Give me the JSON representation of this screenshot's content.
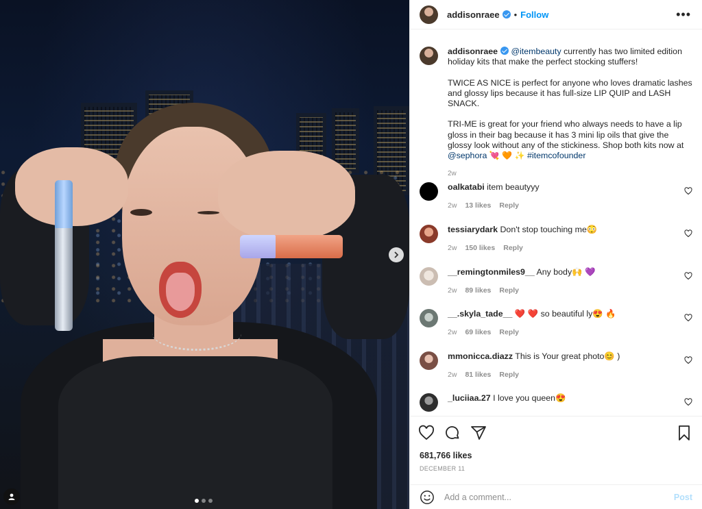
{
  "post": {
    "username": "addisonraee",
    "follow_label": "Follow",
    "separator": "•",
    "more_label": "•••",
    "caption": {
      "mention_start": "@itembeauty",
      "line1": " currently has two limited edition holiday kits that make the perfect stocking stuffers!",
      "para2": "TWICE AS NICE is perfect for anyone who loves dramatic lashes and glossy lips because it has full-size LIP QUIP and LASH SNACK.",
      "para3_text": "TRI-ME is great for your friend who always needs to have a lip gloss in their bag because it has 3 mini lip oils that give the glossy look without any of the stickiness. Shop both kits now at ",
      "para3_mention": "@sephora",
      "para3_emoji1": "💘",
      "para3_emoji2": "🧡",
      "para3_emoji3": "✨",
      "hashtag": "#itemcofounder",
      "time": "2w"
    },
    "likes": "681,766 likes",
    "date": "DECEMBER 11",
    "add_comment_placeholder": "Add a comment...",
    "post_label": "Post"
  },
  "comments": [
    {
      "username": "oalkatabi",
      "text": "item beautyyy",
      "time": "2w",
      "likes": "13 likes",
      "reply": "Reply",
      "avatar_color": "#000000"
    },
    {
      "username": "tessiarydark",
      "text": "Don't stop touching me😳",
      "time": "2w",
      "likes": "150 likes",
      "reply": "Reply",
      "avatar_color": "#c96a4f"
    },
    {
      "username": "__remingtonmiles9__",
      "text": "Any body🙌 💜",
      "time": "2w",
      "likes": "89 likes",
      "reply": "Reply",
      "avatar_color": "#d9ccc2"
    },
    {
      "username": "__.skyla_tade__",
      "text": "❤️ ❤️ so beautiful ly😍 🔥",
      "time": "2w",
      "likes": "69 likes",
      "reply": "Reply",
      "avatar_color": "#9aa8a2"
    },
    {
      "username": "mmonicca.diazz",
      "text": "This is Your great photo😊 )",
      "time": "2w",
      "likes": "81 likes",
      "reply": "Reply",
      "avatar_color": "#c48a8a"
    },
    {
      "username": "_luciiaa.27",
      "text": "I love you queen😍",
      "time": "",
      "likes": "",
      "reply": "",
      "avatar_color": "#3b3b3b"
    }
  ],
  "carousel": {
    "count": 3,
    "active": 1
  },
  "colors": {
    "accent": "#0095f6",
    "link": "#00376b",
    "muted": "#8e8e8e",
    "verified": "#3897f0"
  },
  "icons": [
    "verified-icon",
    "more-icon",
    "heart-icon",
    "comment-icon",
    "share-icon",
    "bookmark-icon",
    "emoji-icon",
    "chevron-right-icon",
    "user-tag-icon"
  ]
}
